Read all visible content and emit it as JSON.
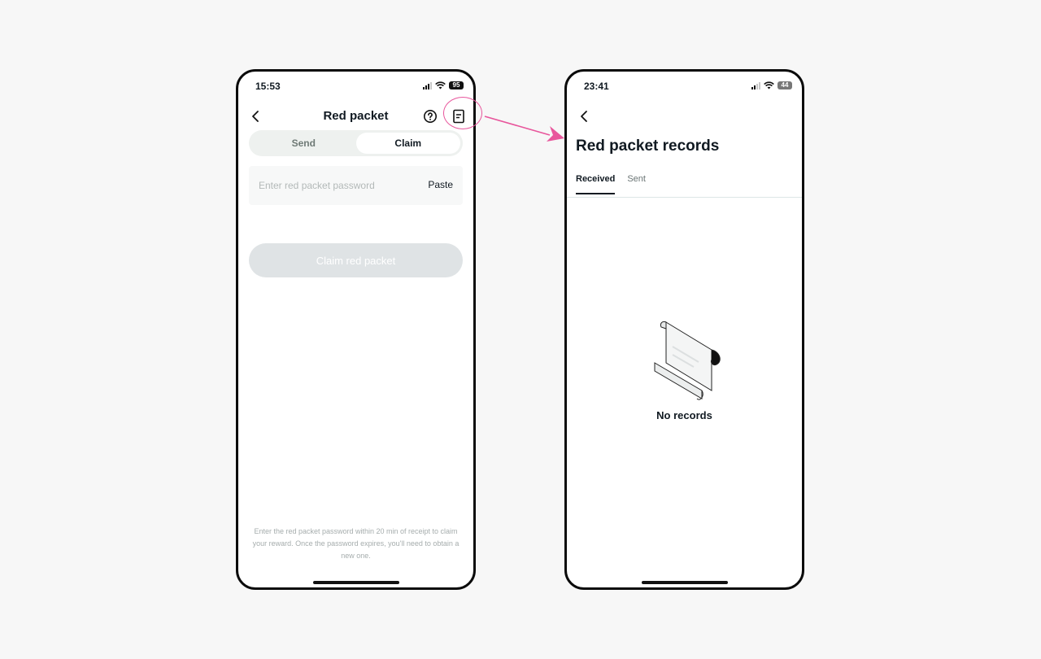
{
  "left_screen": {
    "status_bar": {
      "time": "15:53",
      "battery": "95"
    },
    "nav": {
      "title": "Red packet"
    },
    "segmented": {
      "send_label": "Send",
      "claim_label": "Claim",
      "selected": "Claim"
    },
    "password_field": {
      "value": "",
      "placeholder": "Enter red packet password",
      "paste_label": "Paste"
    },
    "claim_button_label": "Claim red packet",
    "hint": "Enter the red packet password within 20 min of receipt to claim your reward. Once the password expires, you'll need to obtain a new one."
  },
  "right_screen": {
    "status_bar": {
      "time": "23:41",
      "battery": "44"
    },
    "title": "Red packet records",
    "tabs": [
      {
        "label": "Received",
        "active": true
      },
      {
        "label": "Sent",
        "active": false
      }
    ],
    "empty_state": {
      "icon": "scroll-icon",
      "text": "No records"
    }
  },
  "annotation": {
    "color": "#e8569c"
  },
  "colors": {
    "text_primary": "#111a22",
    "disabled_button": "#dfe3e5",
    "segment_bg": "#eef1ef",
    "annotation": "#e8569c"
  },
  "icons": [
    "back-arrow-icon",
    "help-icon",
    "records-icon",
    "signal-icon",
    "wifi-icon",
    "battery-icon",
    "scroll-icon"
  ]
}
